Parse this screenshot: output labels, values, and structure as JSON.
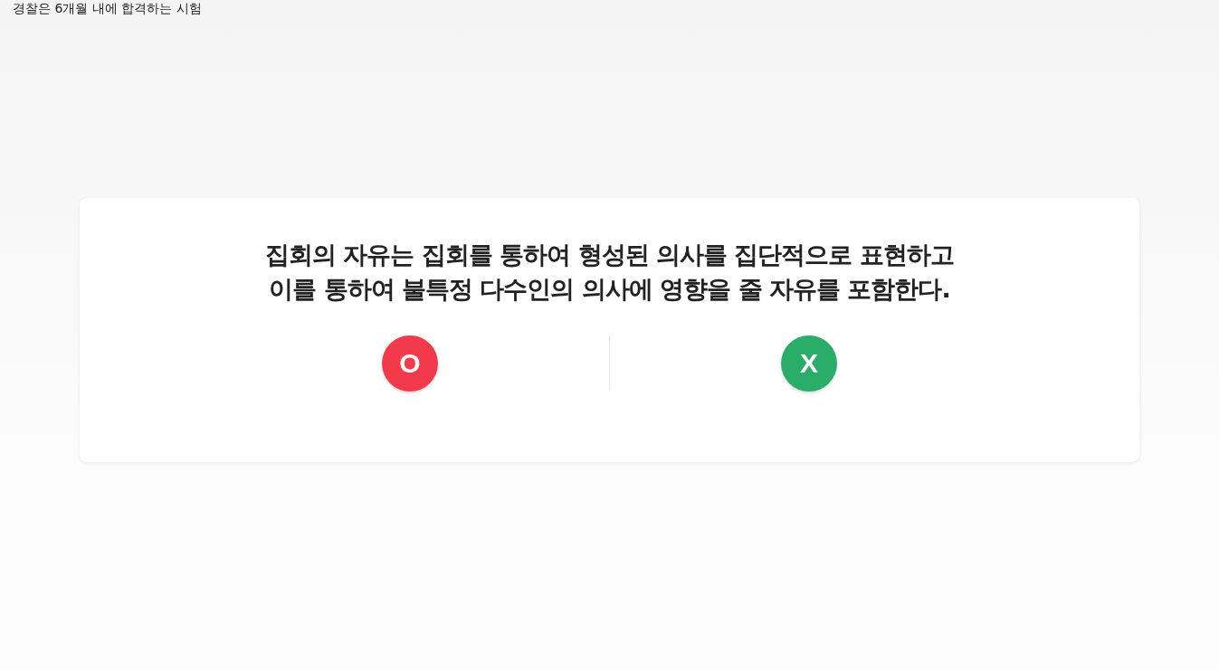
{
  "header": {
    "title": "경찰은 6개월 내에 합격하는 시험"
  },
  "question": {
    "lines": [
      "집회의 자유는 집회를 통하여 형성된 의사를 집단적으로 표현하고",
      "이를 통하여 불특정 다수인의 의사에 영향을 줄 자유를 포함한다."
    ]
  },
  "answers": [
    {
      "label": "O",
      "color": "#f23a4a"
    },
    {
      "label": "X",
      "color": "#2bad6a"
    }
  ]
}
